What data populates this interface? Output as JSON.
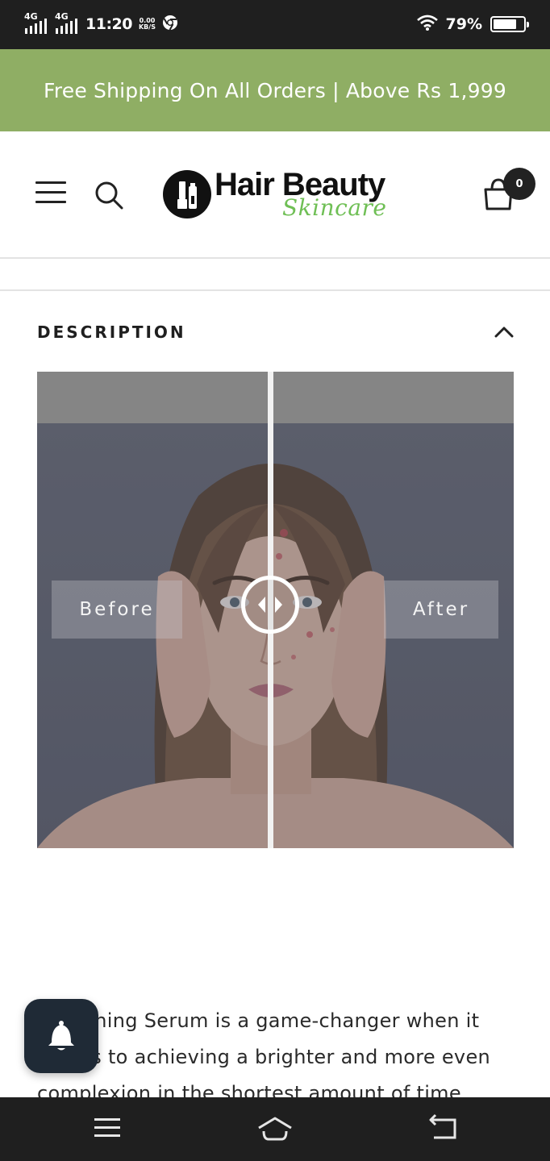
{
  "status_bar": {
    "network_1": "4G",
    "network_2": "4G",
    "time": "11:20",
    "speed_value": "0.00",
    "speed_unit": "KB/S",
    "battery_percent": "79%",
    "battery_level": 0.79
  },
  "announcement": {
    "text": "Free Shipping On All Orders | Above Rs 1,999"
  },
  "header": {
    "brand_title": "Hair Beauty",
    "brand_subtitle": "Skincare",
    "cart_count": "0",
    "icons": [
      "menu-icon",
      "search-icon",
      "cart-icon"
    ]
  },
  "description": {
    "title": "DESCRIPTION",
    "comparison": {
      "before_label": "Before",
      "after_label": "After"
    },
    "text": "Whitening Serum is a game-changer when it comes to achieving a brighter and more even complexion in the shortest amount of time possible."
  },
  "colors": {
    "announcement_bg": "#8fae64",
    "brand_green": "#6fbf55",
    "dark": "#1f1f1f",
    "bell_bg": "#1f2a36"
  },
  "nav": {
    "icons": [
      "recents-icon",
      "home-icon",
      "back-icon"
    ]
  }
}
